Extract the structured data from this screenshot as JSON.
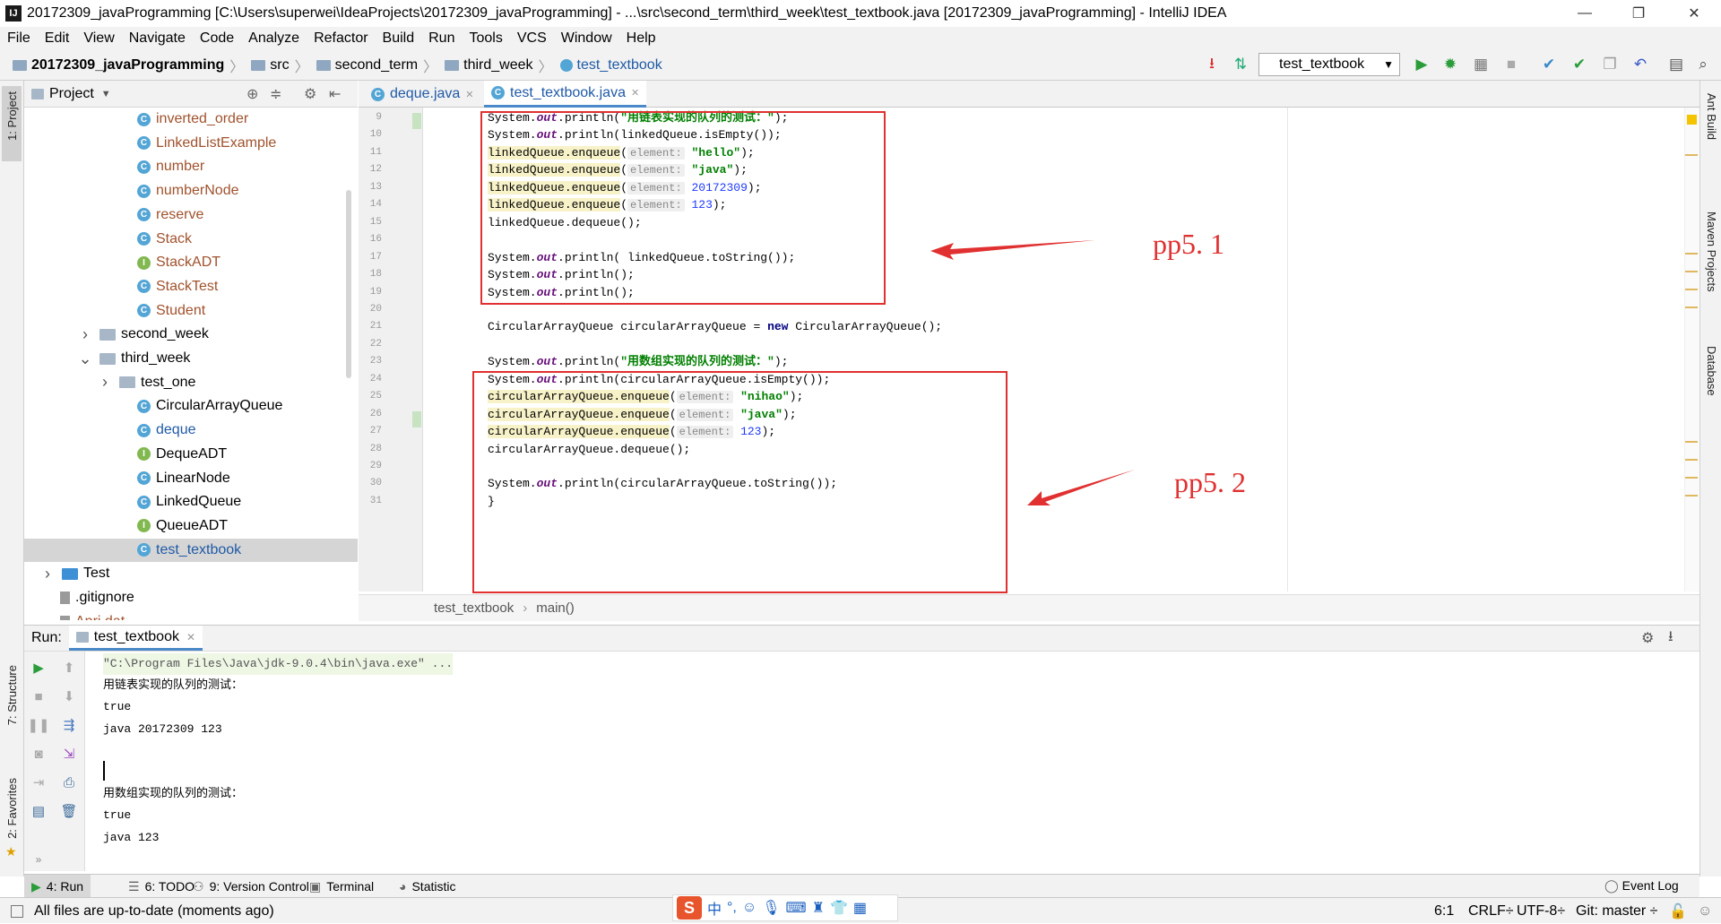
{
  "window": {
    "title": "20172309_javaProgramming [C:\\Users\\superwei\\IdeaProjects\\20172309_javaProgramming] - ...\\src\\second_term\\third_week\\test_textbook.java [20172309_javaProgramming] - IntelliJ IDEA",
    "minimize": "—",
    "restore": "❐",
    "close": "✕"
  },
  "menu": [
    "File",
    "Edit",
    "View",
    "Navigate",
    "Code",
    "Analyze",
    "Refactor",
    "Build",
    "Run",
    "Tools",
    "VCS",
    "Window",
    "Help"
  ],
  "breadcrumbs": [
    {
      "label": "20172309_javaProgramming",
      "bold": true
    },
    {
      "label": "src"
    },
    {
      "label": "second_term"
    },
    {
      "label": "third_week"
    },
    {
      "label": "test_textbook",
      "blue": true
    }
  ],
  "run_config": "test_textbook",
  "project_panel": {
    "title": "Project",
    "items": [
      {
        "label": "inverted_order",
        "icon": "c",
        "color": "brown",
        "indent": 1
      },
      {
        "label": "LinkedListExample",
        "icon": "c",
        "color": "brown",
        "indent": 1
      },
      {
        "label": "number",
        "icon": "c",
        "color": "brown",
        "indent": 1
      },
      {
        "label": "numberNode",
        "icon": "c",
        "color": "brown",
        "indent": 1
      },
      {
        "label": "reserve",
        "icon": "c",
        "color": "brown",
        "indent": 1
      },
      {
        "label": "Stack",
        "icon": "c",
        "color": "brown",
        "indent": 1
      },
      {
        "label": "StackADT",
        "icon": "i",
        "color": "brown",
        "indent": 1
      },
      {
        "label": "StackTest",
        "icon": "c",
        "color": "brown",
        "indent": 1
      },
      {
        "label": "Student",
        "icon": "c",
        "color": "brown",
        "indent": 1
      },
      {
        "label": "second_week",
        "icon": "folder",
        "arrow": ">",
        "indent": 0
      },
      {
        "label": "third_week",
        "icon": "folder",
        "arrow": "v",
        "indent": 0
      },
      {
        "label": "test_one",
        "icon": "folder",
        "arrow": ">",
        "indent": 1
      },
      {
        "label": "CircularArrayQueue",
        "icon": "c",
        "indent": 1
      },
      {
        "label": "deque",
        "icon": "c",
        "color": "blue",
        "indent": 1
      },
      {
        "label": "DequeADT",
        "icon": "i",
        "indent": 1
      },
      {
        "label": "LinearNode",
        "icon": "c",
        "indent": 1
      },
      {
        "label": "LinkedQueue",
        "icon": "c",
        "indent": 1
      },
      {
        "label": "QueueADT",
        "icon": "i",
        "indent": 1
      },
      {
        "label": "test_textbook",
        "icon": "c",
        "color": "blue",
        "indent": 1,
        "selected": true
      },
      {
        "label": "Test",
        "icon": "folder-blue",
        "arrow": ">",
        "indent": -1
      },
      {
        "label": ".gitignore",
        "icon": "file",
        "indent": -0.5
      },
      {
        "label": "Apri.dat",
        "icon": "file",
        "color": "brown",
        "indent": -0.5
      }
    ]
  },
  "editor": {
    "tabs": [
      {
        "label": "deque.java"
      },
      {
        "label": "test_textbook.java",
        "active": true
      }
    ],
    "line_numbers": [
      "9",
      "10",
      "11",
      "12",
      "13",
      "14",
      "15",
      "16",
      "17",
      "18",
      "19",
      "20",
      "21",
      "22",
      "23",
      "24",
      "25",
      "26",
      "27",
      "28",
      "29",
      "30",
      "31"
    ],
    "lines": [
      [
        {
          "t": "System."
        },
        {
          "t": "out",
          "c": "fld"
        },
        {
          "t": ".println("
        },
        {
          "t": "\"用链表实现的队列的测试：\"",
          "c": "str"
        },
        {
          "t": ");"
        }
      ],
      [
        {
          "t": "System."
        },
        {
          "t": "out",
          "c": "fld"
        },
        {
          "t": ".println(linkedQueue.isEmpty());"
        }
      ],
      [
        {
          "t": "linkedQueue.enqueue",
          "c": "hl"
        },
        {
          "t": "("
        },
        {
          "t": "element:",
          "c": "hint"
        },
        {
          "t": " "
        },
        {
          "t": "\"hello\"",
          "c": "str"
        },
        {
          "t": ");"
        }
      ],
      [
        {
          "t": "linkedQueue.enqueue",
          "c": "hl"
        },
        {
          "t": "("
        },
        {
          "t": "element:",
          "c": "hint"
        },
        {
          "t": " "
        },
        {
          "t": "\"java\"",
          "c": "str"
        },
        {
          "t": ");"
        }
      ],
      [
        {
          "t": "linkedQueue.enqueue",
          "c": "hl"
        },
        {
          "t": "("
        },
        {
          "t": "element:",
          "c": "hint"
        },
        {
          "t": " "
        },
        {
          "t": "20172309",
          "c": "num"
        },
        {
          "t": ");"
        }
      ],
      [
        {
          "t": "linkedQueue.enqueue",
          "c": "hl"
        },
        {
          "t": "("
        },
        {
          "t": "element:",
          "c": "hint"
        },
        {
          "t": " "
        },
        {
          "t": "123",
          "c": "num"
        },
        {
          "t": ");"
        }
      ],
      [
        {
          "t": "linkedQueue.dequeue();"
        }
      ],
      [],
      [
        {
          "t": "System."
        },
        {
          "t": "out",
          "c": "fld"
        },
        {
          "t": ".println( linkedQueue.toString());"
        }
      ],
      [
        {
          "t": "System."
        },
        {
          "t": "out",
          "c": "fld"
        },
        {
          "t": ".println();"
        }
      ],
      [
        {
          "t": "System."
        },
        {
          "t": "out",
          "c": "fld"
        },
        {
          "t": ".println();"
        }
      ],
      [],
      [
        {
          "t": "CircularArrayQueue circularArrayQueue = "
        },
        {
          "t": "new",
          "c": "kw"
        },
        {
          "t": " CircularArrayQueue();"
        }
      ],
      [],
      [
        {
          "t": "System."
        },
        {
          "t": "out",
          "c": "fld"
        },
        {
          "t": ".println("
        },
        {
          "t": "\"用数组实现的队列的测试：\"",
          "c": "str"
        },
        {
          "t": ");"
        }
      ],
      [
        {
          "t": "System."
        },
        {
          "t": "out",
          "c": "fld"
        },
        {
          "t": ".println(circularArrayQueue.isEmpty());"
        }
      ],
      [
        {
          "t": "circularArrayQueue.enqueue",
          "c": "hl"
        },
        {
          "t": "("
        },
        {
          "t": "element:",
          "c": "hint"
        },
        {
          "t": " "
        },
        {
          "t": "\"nihao\"",
          "c": "str"
        },
        {
          "t": ");"
        }
      ],
      [
        {
          "t": "circularArrayQueue.enqueue",
          "c": "hl"
        },
        {
          "t": "("
        },
        {
          "t": "element:",
          "c": "hint"
        },
        {
          "t": " "
        },
        {
          "t": "\"java\"",
          "c": "str"
        },
        {
          "t": ");"
        }
      ],
      [
        {
          "t": "circularArrayQueue.enqueue",
          "c": "hl"
        },
        {
          "t": "("
        },
        {
          "t": "element:",
          "c": "hint"
        },
        {
          "t": " "
        },
        {
          "t": "123",
          "c": "num"
        },
        {
          "t": ");"
        }
      ],
      [
        {
          "t": "circularArrayQueue.dequeue();"
        }
      ],
      [],
      [
        {
          "t": "System."
        },
        {
          "t": "out",
          "c": "fld"
        },
        {
          "t": ".println(circularArrayQueue.toString());"
        }
      ],
      [
        {
          "t": "}"
        }
      ]
    ],
    "annotation_1": "pp5. 1",
    "annotation_2": "pp5. 2",
    "crumb_class": "test_textbook",
    "crumb_method": "main()"
  },
  "left_strip": {
    "project": "1: Project",
    "structure": "7: Structure",
    "favorites": "2: Favorites"
  },
  "right_strip": {
    "ant": "Ant Build",
    "maven": "Maven Projects",
    "database": "Database"
  },
  "run_panel": {
    "label": "Run:",
    "tab": "test_textbook",
    "output": [
      {
        "t": "\"C:\\Program Files\\Java\\jdk-9.0.4\\bin\\java.exe\" ...",
        "cmd": true
      },
      {
        "t": "用链表实现的队列的测试："
      },
      {
        "t": "true"
      },
      {
        "t": "java 20172309 123"
      },
      {
        "t": ""
      },
      {
        "t": ""
      },
      {
        "t": "用数组实现的队列的测试："
      },
      {
        "t": "true"
      },
      {
        "t": "java 123"
      }
    ]
  },
  "bottom_tabs": [
    "4: Run",
    "6: TODO",
    "9: Version Control",
    "Terminal",
    "Statistic"
  ],
  "event_log": "Event Log",
  "status": {
    "message": "All files are up-to-date (moments ago)",
    "position": "6:1",
    "line_sep": "CRLF÷",
    "encoding": "UTF-8÷",
    "git": "Git: master ÷"
  },
  "ime": {
    "logo": "S",
    "lang": "中"
  },
  "colors": {
    "accent": "#4a88c7",
    "annotation": "#e03030",
    "selection": "#d5d5d5"
  }
}
